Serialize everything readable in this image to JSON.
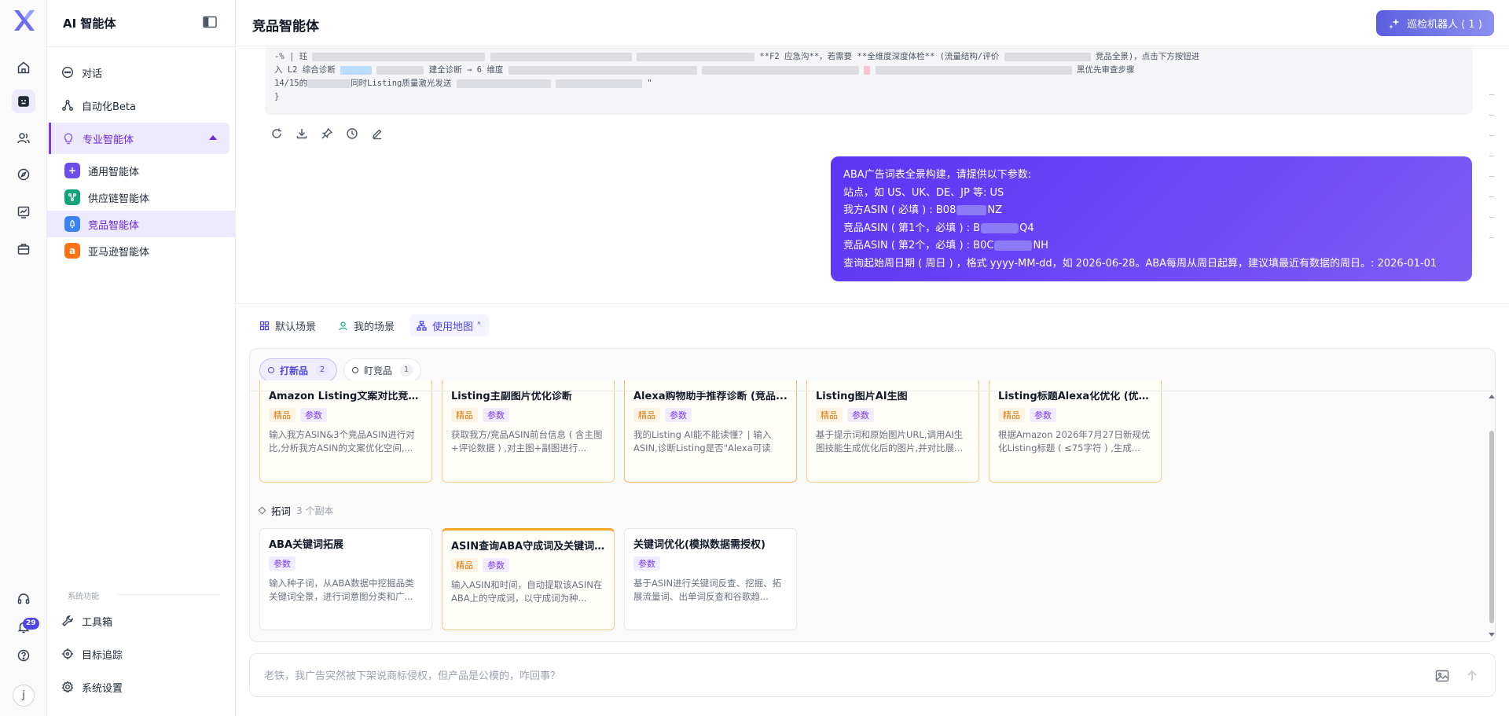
{
  "sidebar": {
    "title": "AI 智能体",
    "nav": {
      "chat": "对话",
      "automation": "自动化Beta",
      "pro_agents": "专业智能体"
    },
    "sub_items": [
      {
        "label": "通用智能体",
        "color": "#6d4ee8"
      },
      {
        "label": "供应链智能体",
        "color": "#12a37c"
      },
      {
        "label": "竞品智能体",
        "color": "#3b82f6"
      },
      {
        "label": "亚马逊智能体",
        "color": "#f97316"
      }
    ],
    "system_label": "系统功能",
    "toolbox": "工具箱",
    "target_tracking": "目标追踪",
    "settings": "系统设置"
  },
  "rail": {
    "notification_count": "29",
    "avatar_initial": "j"
  },
  "header": {
    "title": "竞品智能体",
    "patrol_button": "巡检机器人 ( 1 )"
  },
  "code_block": {
    "line1_start": "-% | 珏",
    "line1_mid": "**F2 应急沟**，若需要 **全维度深度体检** (流量结构/评价",
    "line1_end": "竞品全景)，点击下方按钮进",
    "line2_start": "入 L2 综合诊断",
    "line2_mid": "建全诊断 → 6 维度",
    "line2_end": "黑优先审查步骤",
    "line3_start": "14/15的",
    "line3_mid": "同时Listing质量激光发送",
    "line3_end": "\"",
    "line4": "}"
  },
  "user_message": {
    "lines": [
      "ABA广告词表全景构建，请提供以下参数:",
      "站点，如 US、UK、DE、JP 等: US",
      "我方ASIN ( 必填 ) : B08",
      "竞品ASIN ( 第1个，必填 ) : B",
      "竞品ASIN ( 第2个，必填 ) : B0C",
      "查询起始周日期 ( 周日 ) ，格式 yyyy-MM-dd，如 2026-06-28。ABA每周从周日起算，建议填最近有数据的周日。: 2026-01-01"
    ],
    "line3_tail": "NZ",
    "line4_tail": "Q4",
    "line5_tail": "NH"
  },
  "scene_tabs": {
    "default": "默认场景",
    "mine": "我的场景",
    "usage_map": "使用地图 ˄"
  },
  "pills": [
    {
      "label": "打新品",
      "count": "2"
    },
    {
      "label": "盯竞品",
      "count": "1"
    }
  ],
  "tags": {
    "gold": "精品",
    "param": "参数"
  },
  "cards_row1": [
    {
      "title": "Amazon Listing文案对比竞品...",
      "desc": "输入我方ASIN&3个竞品ASIN进行对比,分析我方ASIN的文案优化空间,..."
    },
    {
      "title": "Listing主副图片优化诊断",
      "desc": "获取我方/竞品ASIN前台信息 ( 含主图+评论数据 ) ,对主图+副图进行..."
    },
    {
      "title": "Alexa购物助手推荐诊断 (竞品...",
      "desc": "我的Listing AI能不能读懂？| 输入ASIN,诊断Listing是否\"Alexa可读可..."
    },
    {
      "title": "Listing图片AI生图",
      "desc": "基于提示词和原始图片URL,调用AI生图技能生成优化后的图片,并对比展..."
    },
    {
      "title": "Listing标题Alexa化优化 (优化...",
      "desc": "根据Amazon 2026年7月27日新规优化Listing标题 ( ≤75字符 ) ,生成..."
    }
  ],
  "group": {
    "name": "拓词",
    "count": "3 个副本"
  },
  "cards_row2": [
    {
      "title": "ABA关键词拓展",
      "desc": "输入种子词，从ABA数据中挖掘品类关键词全景，进行词意图分类和广..."
    },
    {
      "title": "ASIN查询ABA守成词及关键词...",
      "desc": "输入ASIN和时间，自动提取该ASIN在ABA上的守成词，以守成词为种..."
    },
    {
      "title": "关键词优化(模拟数据需授权)",
      "desc": "基于ASIN进行关键词反查、挖掘、拓展流量词、出单词反查和谷歌趋..."
    }
  ],
  "input": {
    "placeholder": "老铁，我广告突然被下架说商标侵权，但产品是公模的，咋回事？"
  },
  "colors": {
    "accent": "#5b34f5",
    "active_nav": "#6d28d9",
    "hot_border": "#f6c98b"
  }
}
